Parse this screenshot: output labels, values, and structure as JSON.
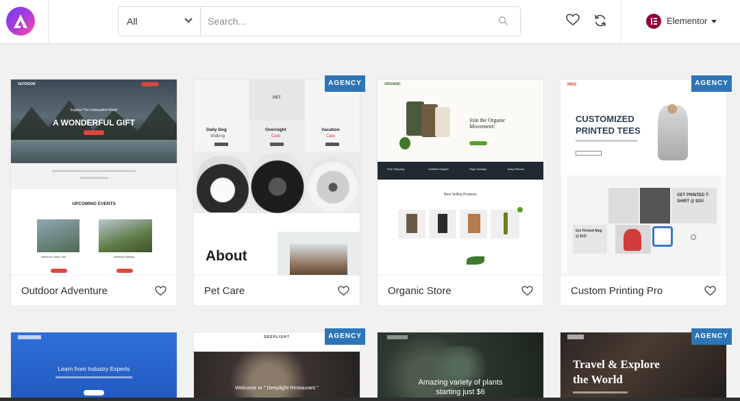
{
  "header": {
    "filter_value": "All",
    "search_placeholder": "Search...",
    "account_name": "Elementor",
    "icons": [
      "astra-logo-icon",
      "chevron-down-icon",
      "search-icon",
      "heart-icon",
      "sync-icon",
      "elementor-icon",
      "caret-down-icon"
    ]
  },
  "badge_label": "AGENCY",
  "colors": {
    "badge": "#2e75b6",
    "elementor": "#92003b"
  },
  "cards": [
    {
      "title": "Outdoor Adventure",
      "thumb": {
        "brand": "OUTDOOR",
        "hero_kicker": "Explore The Unbeautiful World",
        "hero_title": "A WONDERFUL GIFT",
        "section_title": "UPCOMING EVENTS",
        "event_1": "Kasonde Camp Trek",
        "event_2": "Walking Holidays"
      }
    },
    {
      "title": "Pet Care",
      "badge": true,
      "thumb": {
        "logo": "PET",
        "service_1": "Daily Dog",
        "service_1b": "Walking",
        "service_2": "Overnight",
        "service_2b": "Care",
        "service_3": "Vacation",
        "service_3b": "Care",
        "about": "About"
      }
    },
    {
      "title": "Organic Store",
      "thumb": {
        "logo": "ORGANIC",
        "hero_title_1": "Join the Organic",
        "hero_title_2": "Movement!",
        "features": [
          "Free Shipping",
          "Certified Organic",
          "Huge Savings",
          "Easy Returns"
        ],
        "section_title": "Best Selling Products"
      }
    },
    {
      "title": "Custom Printing Pro",
      "badge": true,
      "thumb": {
        "logo": "PRO",
        "hero_title_1": "CUSTOMIZED",
        "hero_title_2": "PRINTED TEES",
        "promo_1": "GET PRINTED T-",
        "promo_1b": "SHIRT @ $25!",
        "promo_2": "Get Printed Mug",
        "promo_2b": "@ $15!"
      }
    },
    {
      "title": "",
      "thumb": {
        "hero_title": "Learn from Industry Experts"
      }
    },
    {
      "title": "",
      "badge": true,
      "thumb": {
        "logo": "DEEPLIGHT",
        "hero_title": "Welcome to \" Deeplight Restaurant \""
      }
    },
    {
      "title": "",
      "thumb": {
        "hero_title_1": "Amazing variety of plants",
        "hero_title_2": "starting just $6"
      }
    },
    {
      "title": "",
      "badge": true,
      "thumb": {
        "hero_title_1": "Travel & Explore",
        "hero_title_2": "the World"
      }
    }
  ]
}
